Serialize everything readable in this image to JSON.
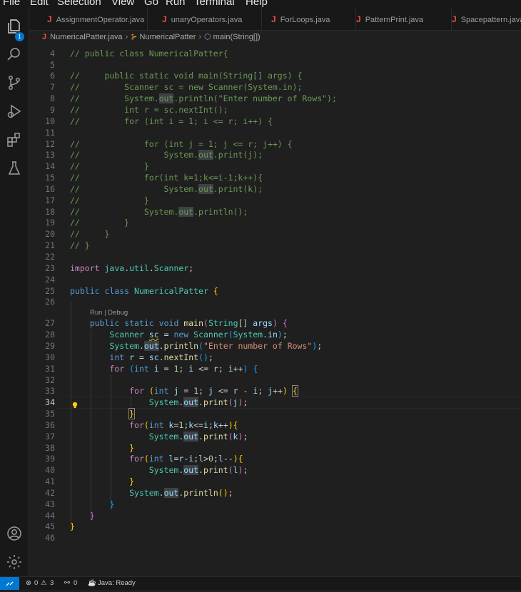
{
  "menu": [
    "File",
    "Edit",
    "Selection",
    "View",
    "Go",
    "Run",
    "Terminal",
    "Help"
  ],
  "activity": {
    "explorer_badge": "1"
  },
  "tabs": [
    {
      "label": "AssignmentOperator.java"
    },
    {
      "label": "unaryOperators.java"
    },
    {
      "label": "ForLoops.java"
    },
    {
      "label": "PatternPrint.java"
    },
    {
      "label": "Spacepattern.java"
    }
  ],
  "breadcrumb": {
    "file": "NumericalPatter.java",
    "class": "NumericalPatter",
    "method": "main(String[])"
  },
  "editor": {
    "codelens": "Run | Debug",
    "line_numbers": [
      "4",
      "5",
      "6",
      "7",
      "8",
      "9",
      "10",
      "11",
      "12",
      "13",
      "14",
      "15",
      "16",
      "17",
      "18",
      "19",
      "20",
      "21",
      "22",
      "23",
      "24",
      "25",
      "26",
      "27",
      "28",
      "29",
      "30",
      "31",
      "32",
      "33",
      "34",
      "35",
      "36",
      "37",
      "38",
      "39",
      "40",
      "41",
      "42",
      "43",
      "44",
      "45",
      "46"
    ],
    "current_line": "34"
  },
  "status": {
    "errors": "0",
    "warnings": "3",
    "ports": "0",
    "java": "Java: Ready"
  },
  "colors": {
    "accent": "#0078d4",
    "background": "#1f1f1f",
    "comment": "#6a9955",
    "keyword": "#569cd6"
  }
}
